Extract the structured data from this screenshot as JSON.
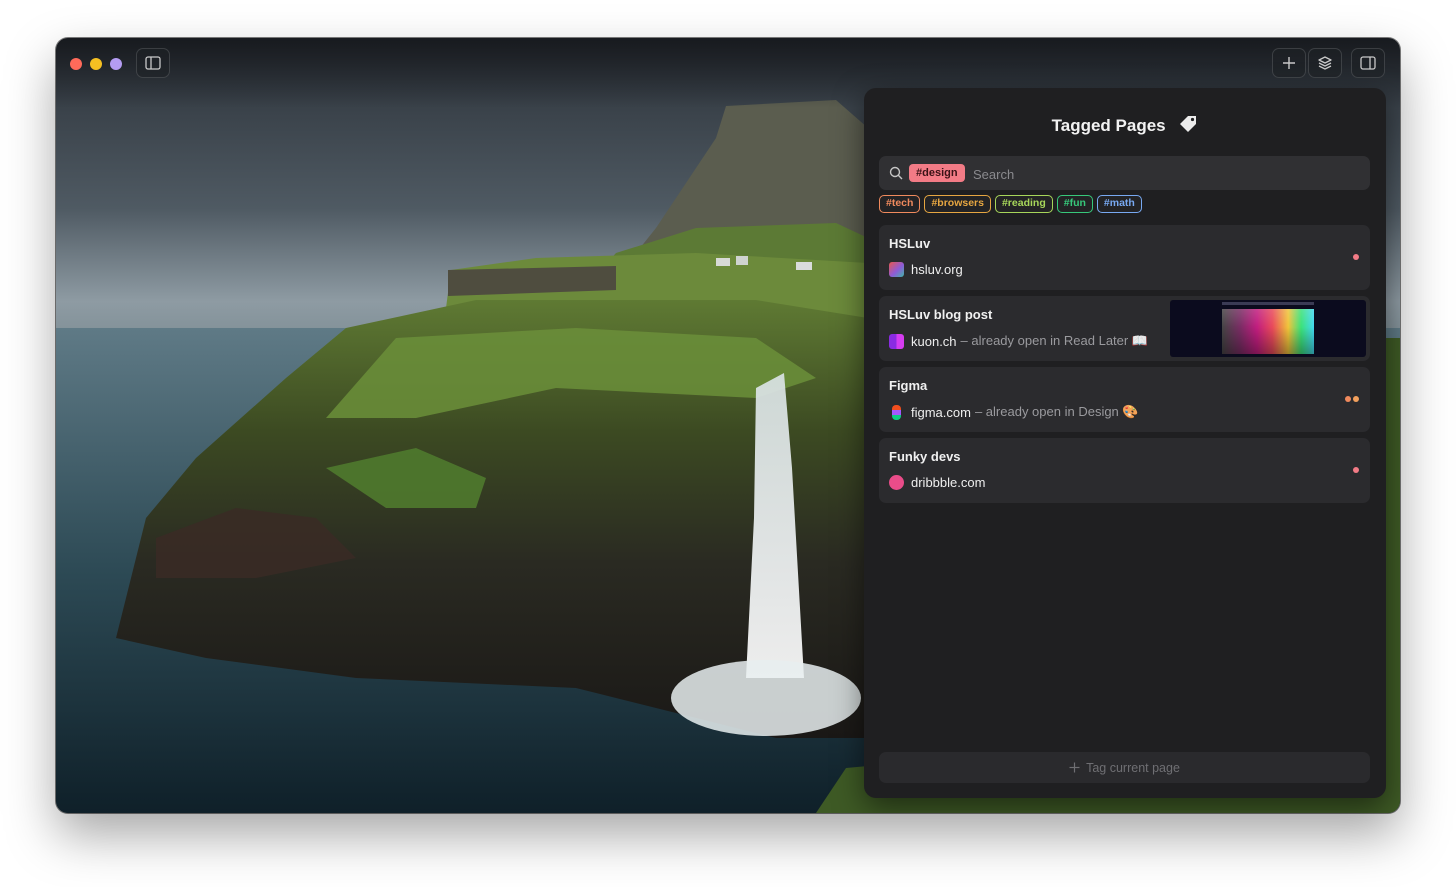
{
  "titlebar": {
    "traffic_lights": [
      "close",
      "minimize",
      "zoom"
    ],
    "buttons": [
      "sidebar-toggle-icon",
      "plus-icon",
      "layers-icon",
      "right-panel-icon"
    ]
  },
  "panel": {
    "title": "Tagged Pages",
    "search": {
      "active_tag": "#design",
      "placeholder": "Search"
    },
    "tags": [
      {
        "label": "#tech",
        "color": "#f08a5d"
      },
      {
        "label": "#browsers",
        "color": "#e6a641"
      },
      {
        "label": "#reading",
        "color": "#a7d65a"
      },
      {
        "label": "#fun",
        "color": "#37c87a"
      },
      {
        "label": "#math",
        "color": "#78a9f2"
      }
    ],
    "pages": [
      {
        "title": "HSLuv",
        "domain": "hsluv.org",
        "note": "",
        "dots": 1
      },
      {
        "title": "HSLuv blog post",
        "domain": "kuon.ch",
        "note": "– already open in Read Later 📖",
        "dots": 0
      },
      {
        "title": "Figma",
        "domain": "figma.com",
        "note": "– already open in Design 🎨",
        "dots": 2
      },
      {
        "title": "Funky devs",
        "domain": "dribbble.com",
        "note": "",
        "dots": 1
      }
    ],
    "tag_button_label": "Tag current page"
  },
  "colors": {
    "accent_tag": "#f27b86",
    "panel_bg": "#1f1f21",
    "card_bg": "#2b2b2e"
  }
}
